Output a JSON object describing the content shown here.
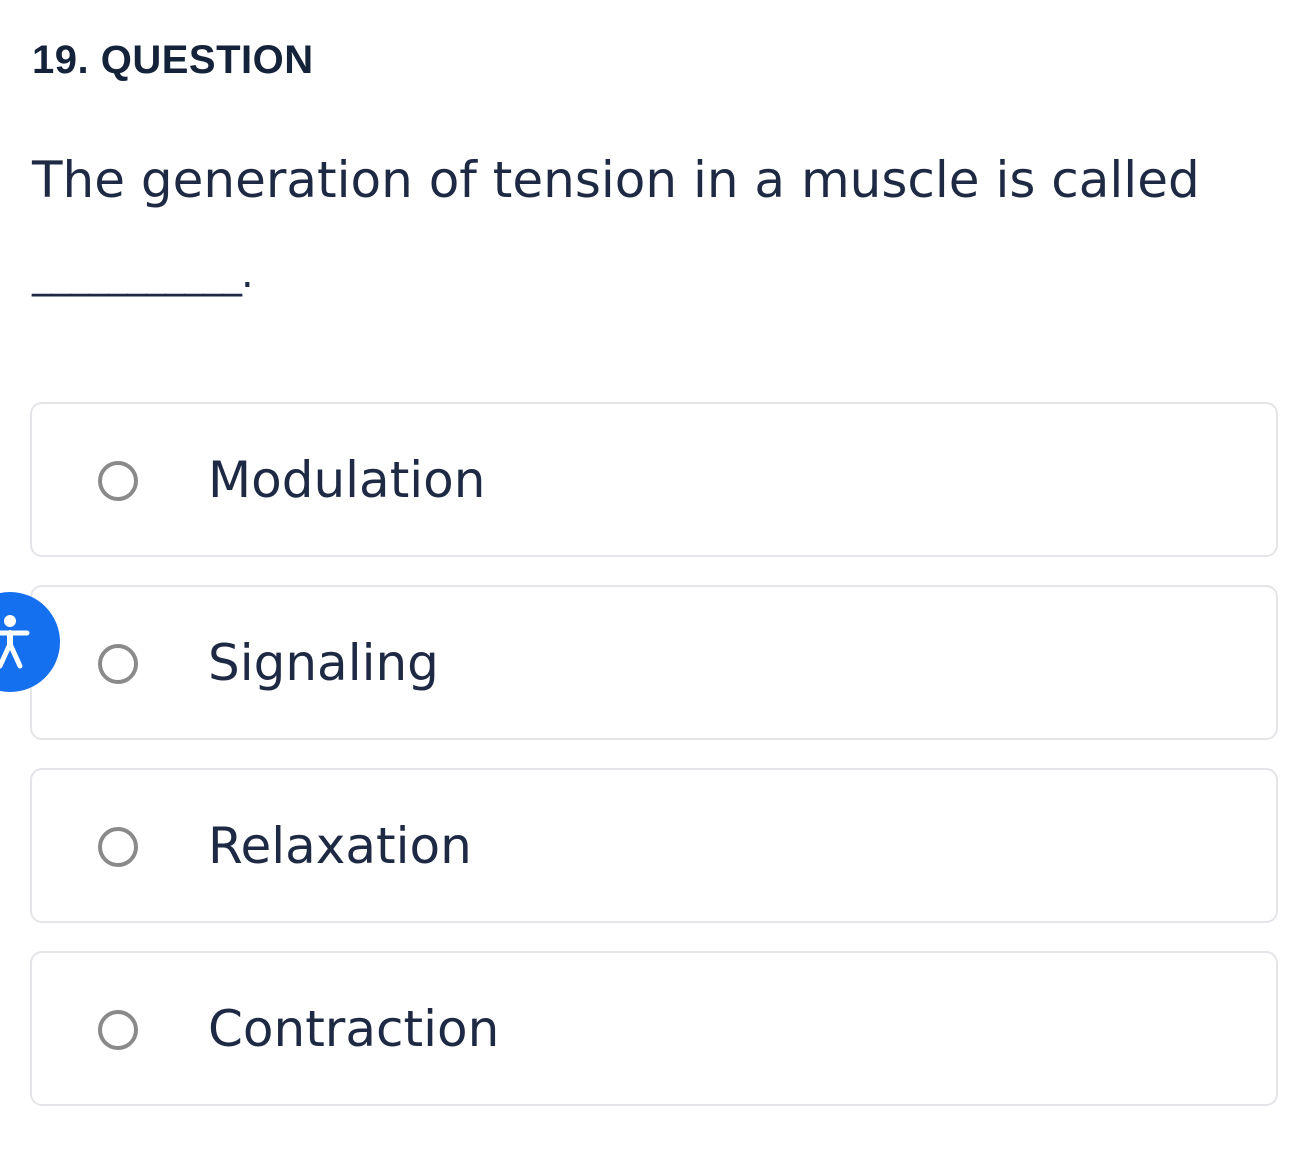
{
  "question": {
    "number_label": "19. QUESTION",
    "text": "The generation of tension in a muscle is called",
    "blank": "___________."
  },
  "options": [
    {
      "label": "Modulation",
      "selected": false
    },
    {
      "label": "Signaling",
      "selected": false
    },
    {
      "label": "Relaxation",
      "selected": false
    },
    {
      "label": "Contraction",
      "selected": false
    }
  ],
  "accessibility": {
    "icon": "accessibility-icon",
    "color": "#1570ef"
  }
}
